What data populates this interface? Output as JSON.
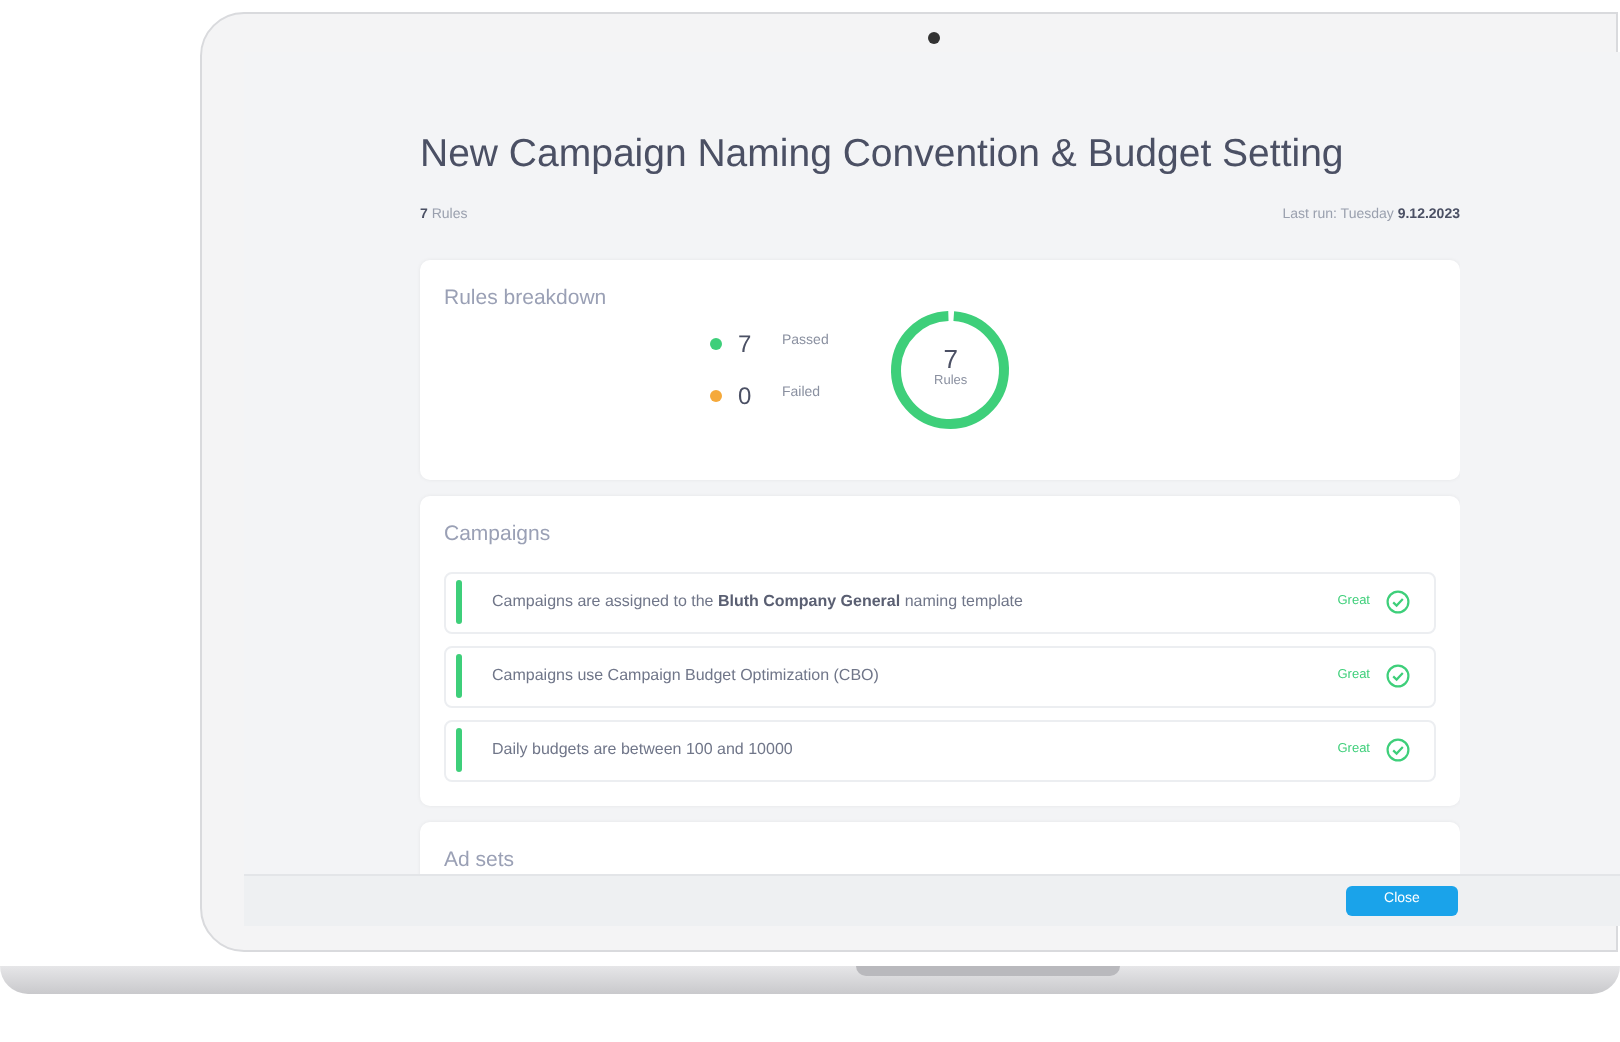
{
  "title": "New Campaign Naming Convention & Budget Setting",
  "rules_count": "**7** Rules",
  "last_run": "Last run: Tuesday **9.12.2023**",
  "breakdown": {
    "title": "Rules breakdown",
    "legend": [
      {
        "count": "7",
        "label": "Passed",
        "color": "#3ecf7a"
      },
      {
        "count": "0",
        "label": "Failed",
        "color": "#f5a93b"
      }
    ],
    "ring": {
      "count": "7",
      "label": "Rules",
      "level": 1
    }
  },
  "sections": [
    {
      "title": "Campaigns",
      "rules": [
        {
          "text": "Campaigns are assigned to the **Bluth Company General** naming template",
          "status": "Great",
          "passed": true
        },
        {
          "text": "Campaigns use Campaign Budget Optimization (CBO)",
          "status": "Great",
          "passed": true
        },
        {
          "text": "Daily budgets are between 100 and 10000",
          "status": "Great",
          "passed": true
        }
      ]
    },
    {
      "title": "Ad sets"
    }
  ],
  "footer": {
    "button": "Close"
  }
}
